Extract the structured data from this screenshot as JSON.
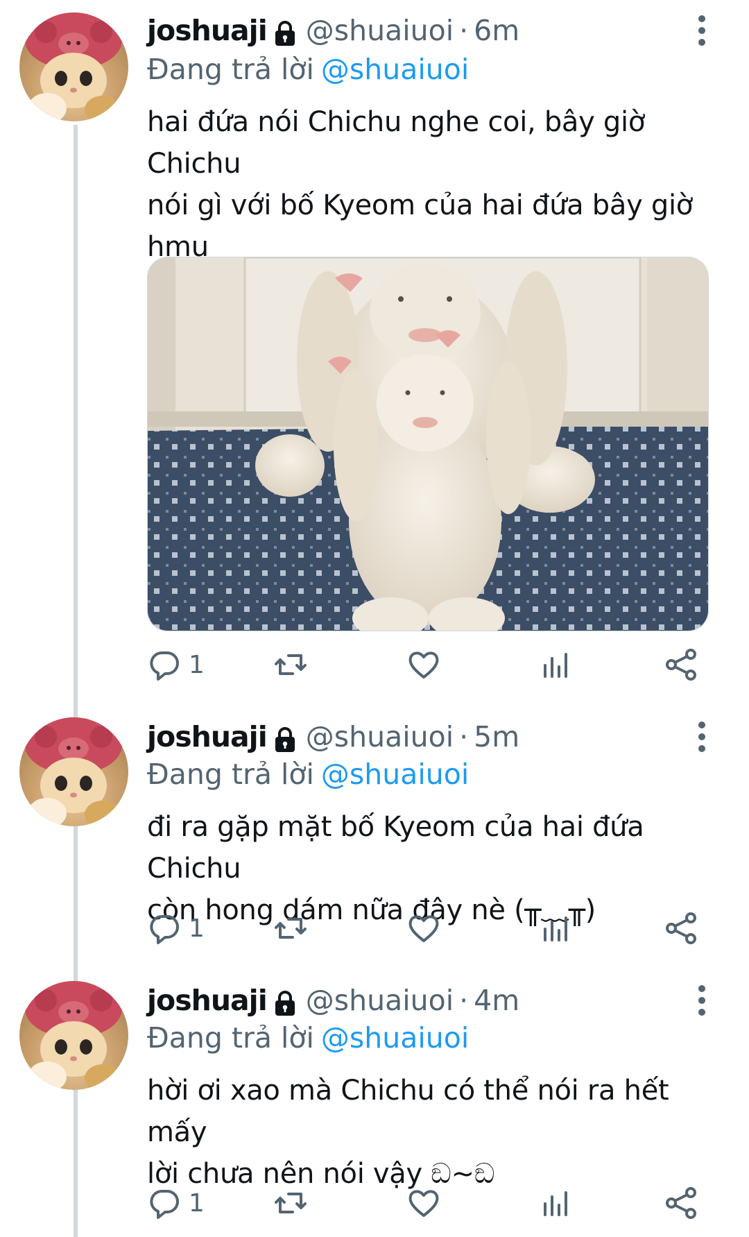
{
  "colors": {
    "link": "#1d9bf0",
    "secondary": "#536471",
    "text": "#0f1419",
    "thread_line": "#cfd9de"
  },
  "icons": {
    "lock": "lock-icon",
    "more": "more-vertical-icon",
    "reply": "reply-icon",
    "retweet": "retweet-icon",
    "like": "heart-icon",
    "views": "bar-chart-icon",
    "share": "share-icon"
  },
  "tweets": [
    {
      "name": "joshuaji",
      "handle": "@shuaiuoi",
      "time": "6m",
      "reply_prefix": "Đang trả lời",
      "reply_to": "@shuaiuoi",
      "text": "hai đứa nói Chichu nghe coi, bây giờ Chichu\nnói gì với bố Kyeom của hai đứa bây giờ hmu\nhmu ඞ_ඞ",
      "reply_count": "1"
    },
    {
      "name": "joshuaji",
      "handle": "@shuaiuoi",
      "time": "5m",
      "reply_prefix": "Đang trả lời",
      "reply_to": "@shuaiuoi",
      "text": "đi ra gặp mặt bố Kyeom của hai đứa Chichu\ncòn hong dám nữa đây nè (╥﹏╥)",
      "reply_count": "1"
    },
    {
      "name": "joshuaji",
      "handle": "@shuaiuoi",
      "time": "4m",
      "reply_prefix": "Đang trả lời",
      "reply_to": "@shuaiuoi",
      "text": "hời ơi xao mà Chichu có thể nói ra hết mấy\nlời chưa nên nói vậy ඞ~ඞ",
      "reply_count": "1"
    }
  ]
}
